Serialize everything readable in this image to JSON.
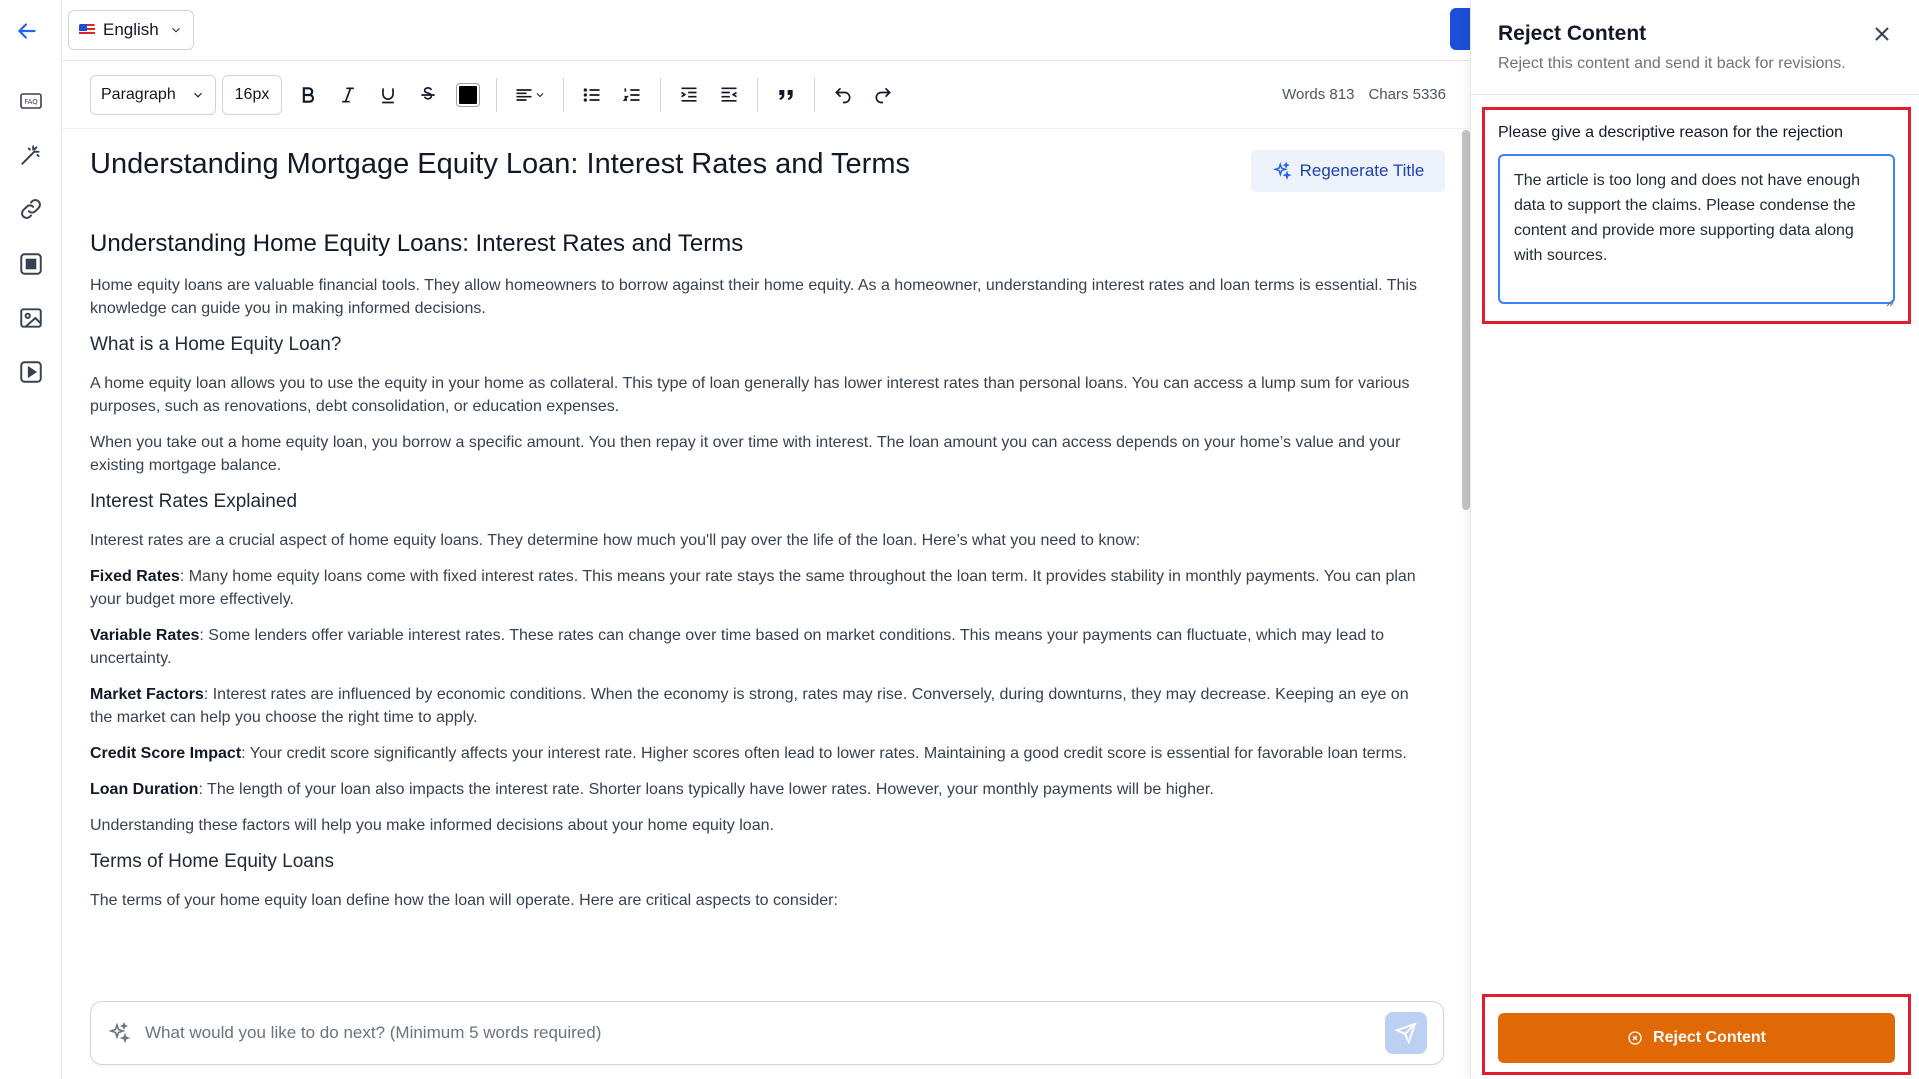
{
  "topbar": {
    "language": "English"
  },
  "toolbar": {
    "block_type": "Paragraph",
    "font_size": "16px",
    "words": "Words 813",
    "chars": "Chars 5336"
  },
  "document": {
    "title": "Understanding Mortgage Equity Loan: Interest Rates and Terms",
    "regenerate_label": "Regenerate Title",
    "h2": "Understanding Home Equity Loans: Interest Rates and Terms",
    "intro": "Home equity loans are valuable financial tools. They allow homeowners to borrow against their home equity. As a homeowner, understanding interest rates and loan terms is essential. This knowledge can guide you in making informed decisions.",
    "h3_1": "What is a Home Equity Loan?",
    "p1": "A home equity loan allows you to use the equity in your home as collateral. This type of loan generally has lower interest rates than personal loans. You can access a lump sum for various purposes, such as renovations, debt consolidation, or education expenses.",
    "p2": "When you take out a home equity loan, you borrow a specific amount. You then repay it over time with interest. The loan amount you can access depends on your home’s value and your existing mortgage balance.",
    "h3_2": "Interest Rates Explained",
    "p3": "Interest rates are a crucial aspect of home equity loans. They determine how much you'll pay over the life of the loan. Here’s what you need to know:",
    "items": [
      {
        "term": "Fixed Rates",
        "text": ": Many home equity loans come with fixed interest rates. This means your rate stays the same throughout the loan term. It provides stability in monthly payments. You can plan your budget more effectively."
      },
      {
        "term": "Variable Rates",
        "text": ": Some lenders offer variable interest rates. These rates can change over time based on market conditions. This means your payments can fluctuate, which may lead to uncertainty."
      },
      {
        "term": "Market Factors",
        "text": ": Interest rates are influenced by economic conditions. When the economy is strong, rates may rise. Conversely, during downturns, they may decrease. Keeping an eye on the market can help you choose the right time to apply."
      },
      {
        "term": "Credit Score Impact",
        "text": ": Your credit score significantly affects your interest rate. Higher scores often lead to lower rates. Maintaining a good credit score is essential for favorable loan terms."
      },
      {
        "term": "Loan Duration",
        "text": ": The length of your loan also impacts the interest rate. Shorter loans typically have lower rates. However, your monthly payments will be higher."
      }
    ],
    "p4": "Understanding these factors will help you make informed decisions about your home equity loan.",
    "h3_3": "Terms of Home Equity Loans",
    "p5": "The terms of your home equity loan define how the loan will operate. Here are critical aspects to consider:"
  },
  "prompt": {
    "placeholder": "What would you like to do next? (Minimum 5 words required)"
  },
  "panel": {
    "title": "Reject Content",
    "subtitle": "Reject this content and send it back for revisions.",
    "reason_label": "Please give a descriptive reason for the rejection",
    "reason_value": "The article is too long and does not have enough data to support the claims. Please condense the content and provide more supporting data along with sources.",
    "reject_button": "Reject Content"
  },
  "colors": {
    "accent": "#2563eb",
    "reject": "#e06805",
    "highlight": "#e11d2f"
  }
}
